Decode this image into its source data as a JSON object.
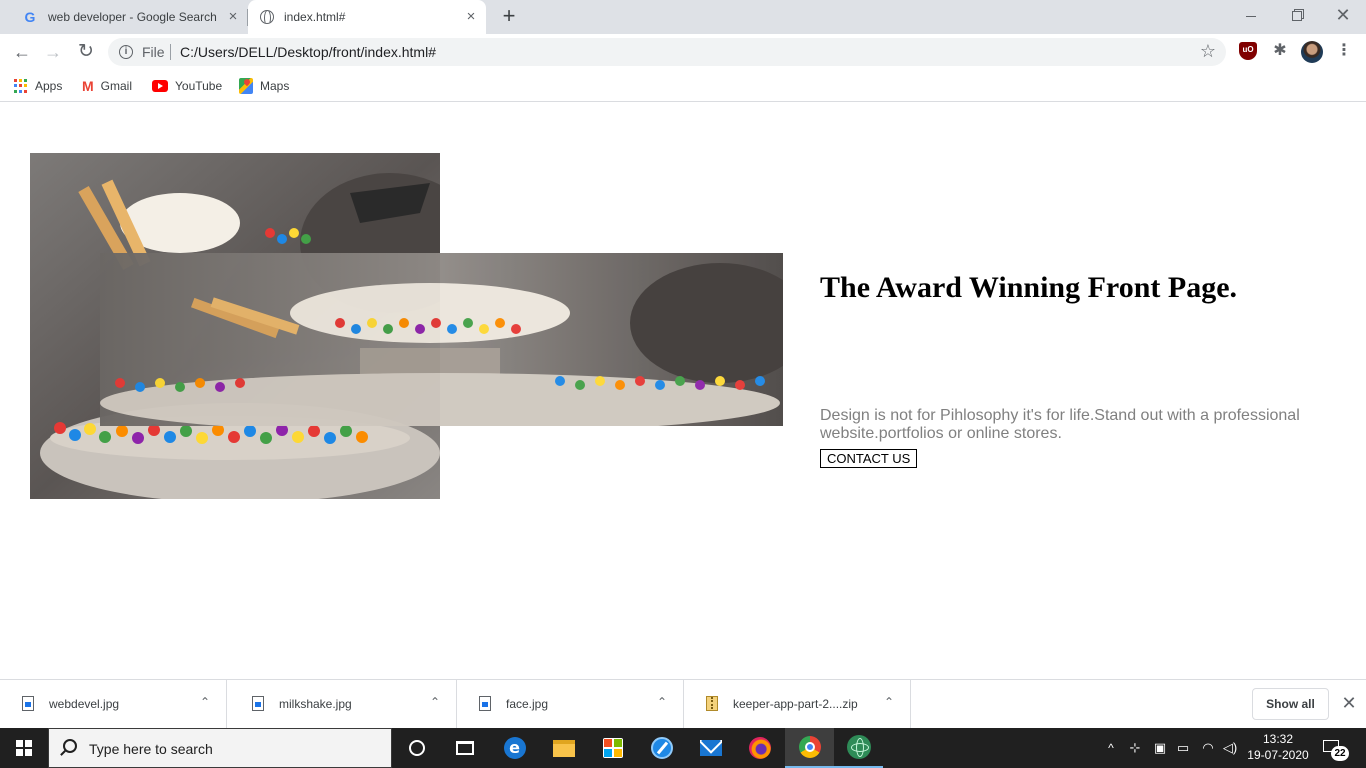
{
  "browser": {
    "tabs": [
      {
        "title": "web developer - Google Search",
        "favicon": "google-g-icon",
        "active": false
      },
      {
        "title": "index.html#",
        "favicon": "globe-icon",
        "active": true
      }
    ],
    "new_tab_symbol": "+",
    "close_symbol": "×",
    "window_close_symbol": "✕",
    "nav": {
      "back": "←",
      "forward": "→",
      "reload": "↻"
    },
    "address": {
      "scheme_label": "File",
      "url": "C:/Users/DELL/Desktop/front/index.html#"
    },
    "star_symbol": "☆",
    "extension_symbol": "✱",
    "menu_symbol": "⋮",
    "bookmarks": [
      {
        "label": "Apps",
        "icon": "apps-grid-icon"
      },
      {
        "label": "Gmail",
        "icon": "gmail-icon"
      },
      {
        "label": "YouTube",
        "icon": "youtube-icon"
      },
      {
        "label": "Maps",
        "icon": "maps-icon"
      }
    ]
  },
  "page": {
    "title": "The Award Winning Front Page.",
    "description": "Design is not for Pihlosophy it's for life.Stand out with a professional website.portfolios or online stores.",
    "contact_button": "CONTACT US",
    "images": [
      {
        "name": "milkshake-photo-back",
        "subject": "milkshake with candy-coated chocolates and wafer sticks"
      },
      {
        "name": "milkshake-photo-front",
        "subject": "milkshake with candy-coated chocolates (stretched)"
      }
    ]
  },
  "downloads": {
    "items": [
      {
        "name": "webdevel.jpg",
        "type": "image"
      },
      {
        "name": "milkshake.jpg",
        "type": "image"
      },
      {
        "name": "face.jpg",
        "type": "image"
      },
      {
        "name": "keeper-app-part-2....zip",
        "type": "zip"
      }
    ],
    "caret_symbol": "⌃",
    "show_all": "Show all",
    "close_symbol": "✕"
  },
  "taskbar": {
    "search_placeholder": "Type here to search",
    "apps": [
      "cortana",
      "task-view",
      "edge",
      "file-explorer",
      "microsoft-store",
      "safari",
      "mail",
      "firefox",
      "chrome",
      "atom"
    ],
    "tray_up_symbol": "^",
    "time": "13:32",
    "date": "19-07-2020",
    "notification_count": "22"
  },
  "colors": {
    "tabstrip": "#dee1e6",
    "title_text": "#000000",
    "description_text": "#808080",
    "taskbar": "#202020",
    "taskbar_accent": "#76b9ed"
  }
}
